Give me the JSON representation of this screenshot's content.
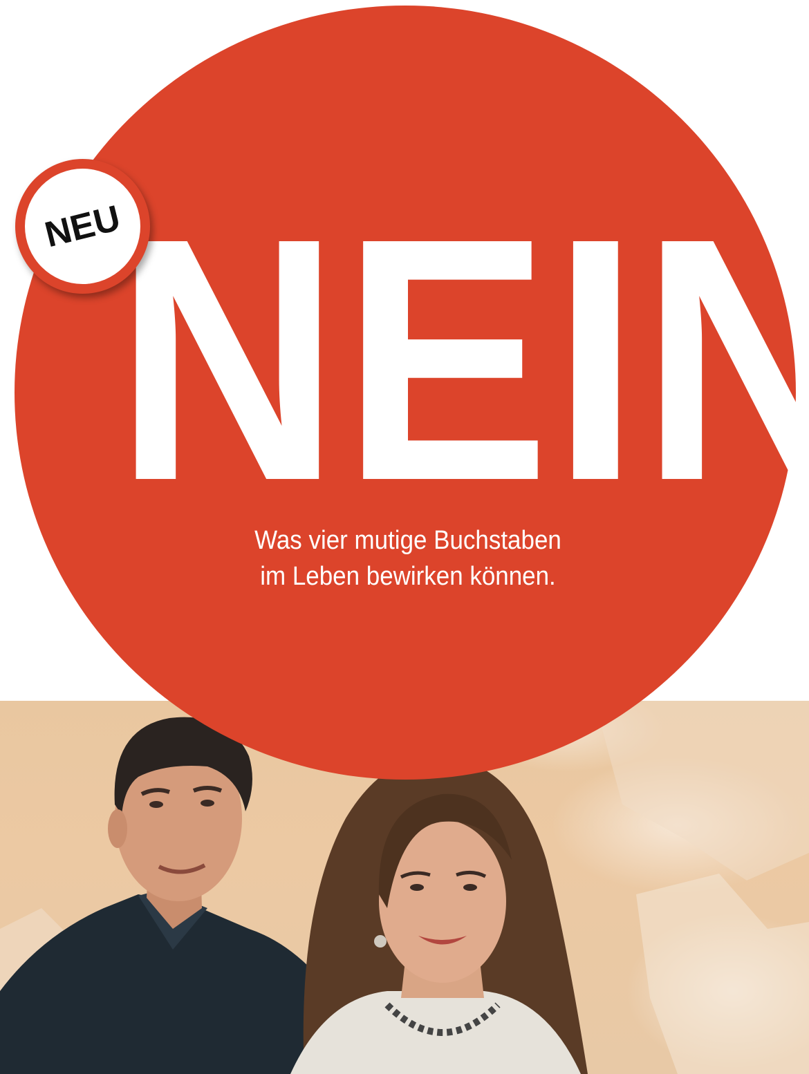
{
  "badge": {
    "label": "NEU"
  },
  "hero": {
    "title": "NEIN",
    "subtitle_lines": [
      "Was vier mutige Buchstaben",
      "im Leben bewirken können."
    ]
  },
  "photo": {
    "icon": "portrait-photo-icon"
  },
  "colors": {
    "accent": "#dc442b",
    "text_on_accent": "#ffffff",
    "badge_text": "#111111",
    "wall": "#e9c7a0"
  }
}
